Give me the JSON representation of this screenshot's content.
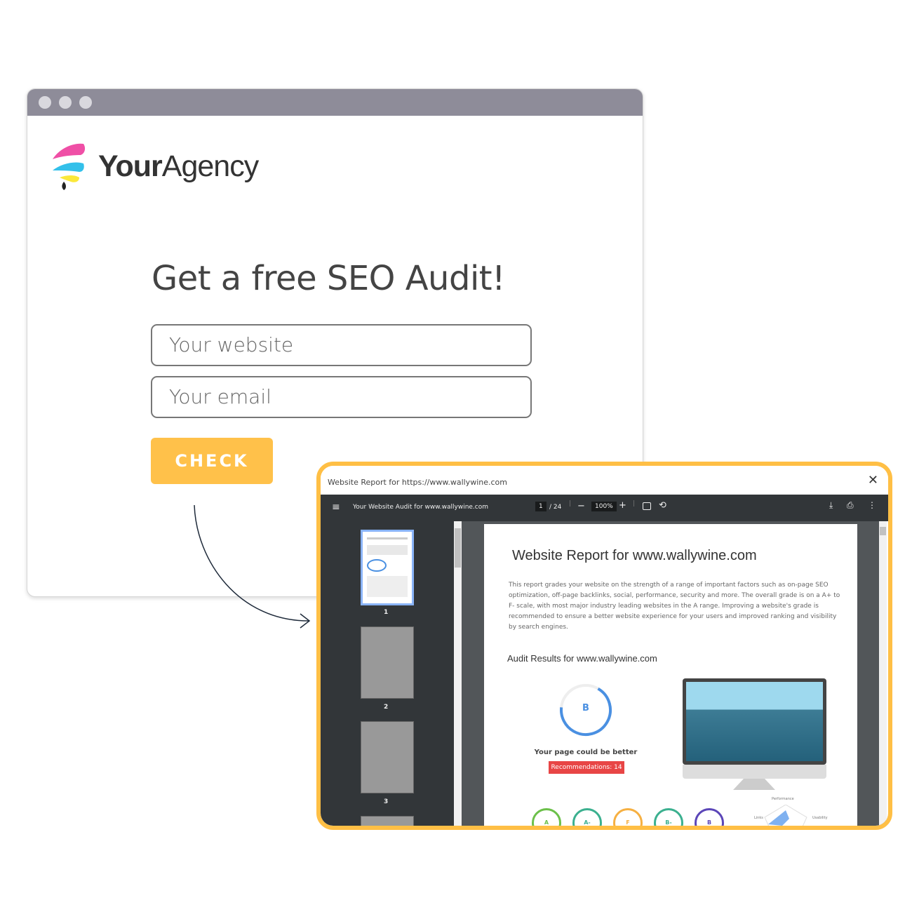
{
  "brand": {
    "name_bold": "Your",
    "name_light": "Agency"
  },
  "form": {
    "heading": "Get a free SEO Audit!",
    "website_placeholder": "Your website",
    "email_placeholder": "Your email",
    "check_label": "CHECK"
  },
  "popup": {
    "title": "Website Report for https://www.wallywine.com",
    "toolbar": {
      "doc_title": "Your Website Audit for www.wallywine.com",
      "page": "1",
      "total": "/ 24",
      "zoom": "100%"
    },
    "thumbs": [
      "1",
      "2",
      "3"
    ],
    "report": {
      "title": "Website Report for www.wallywine.com",
      "intro": "This report grades your website on the strength of a range of important factors such as on-page SEO optimization, off-page backlinks, social, performance, security and more. The overall grade is on a A+ to F- scale, with most major industry leading websites in the A range. Improving a website's grade is recommended to ensure a better website experience for your users and improved ranking and visibility by search engines.",
      "audit_heading": "Audit Results for www.wallywine.com",
      "grade": "B",
      "grade_caption": "Your page could be better",
      "recommendations": "Recommendations: 14",
      "sub_grades": [
        {
          "g": "A",
          "c": "#6cc04a"
        },
        {
          "g": "A-",
          "c": "#3bb08f"
        },
        {
          "g": "F",
          "c": "#f6b042"
        },
        {
          "g": "B-",
          "c": "#3bb08f"
        },
        {
          "g": "B",
          "c": "#5b46b8"
        }
      ],
      "radar_labels": [
        "Performance",
        "Links",
        "Usability"
      ]
    }
  },
  "colors": {
    "accent": "#ffc14a",
    "popup_border": "#ffbf45",
    "titlebar": "#8e8c99",
    "viewer_dark": "#323639",
    "grade_blue": "#4a90e2",
    "rec_red": "#e84545"
  }
}
